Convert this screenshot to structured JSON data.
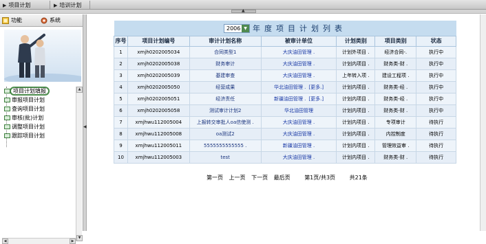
{
  "topbar": {
    "crumb1": "项目计划",
    "crumb2": "培训计划"
  },
  "sidebar": {
    "tab_function": "功能",
    "tab_system": "系统",
    "tree": [
      {
        "label": "项目计划填报",
        "selected": true
      },
      {
        "label": "审报项目计划"
      },
      {
        "label": "查询项目计划"
      },
      {
        "label": "审核(批)计划"
      },
      {
        "label": "调整项目计划"
      },
      {
        "label": "跟踪项目计划"
      }
    ]
  },
  "grid": {
    "year": "2006",
    "title": "年度项目计划列表",
    "headers": [
      "序号",
      "项目计划编号",
      "审计计划名称",
      "被审计单位",
      "计划类别",
      "项目类别",
      "状态"
    ],
    "rows": [
      {
        "no": "1",
        "code": "xmjh0202005034",
        "name": "合同类型1",
        "unit": "大庆油田管理 .",
        "more": "",
        "plan": "计划外项目 .",
        "type": "经济合同-.",
        "status": "执行中"
      },
      {
        "no": "2",
        "code": "xmjh0202005038",
        "name": "财务审计",
        "unit": "大庆油田管理 .",
        "more": "",
        "plan": "计划内项目 .",
        "type": "财务类-财 .",
        "status": "执行中"
      },
      {
        "no": "3",
        "code": "xmjh0202005039",
        "name": "基建审查",
        "unit": "大庆油田管理 .",
        "more": "",
        "plan": "上年转入项 .",
        "type": "建设工程项 .",
        "status": "执行中"
      },
      {
        "no": "4",
        "code": "xmjh0202005050",
        "name": "经营成果",
        "unit": "华北油田管理 .",
        "more": "[更多.]",
        "plan": "计划内项目 .",
        "type": "财务类-经 .",
        "status": "执行中"
      },
      {
        "no": "5",
        "code": "xmjh0202005051",
        "name": "经济责任",
        "unit": "新疆油田管理 .",
        "more": "[更多.]",
        "plan": "计划内项目 .",
        "type": "财务类-经 .",
        "status": "执行中"
      },
      {
        "no": "6",
        "code": "xmjh0202005058",
        "name": "测试审计计划2",
        "unit": "华北油田管理",
        "more": "",
        "plan": "计划内项目 .",
        "type": "财务类-财 .",
        "status": "执行中"
      },
      {
        "no": "7",
        "code": "xmjhwu112005004",
        "name": "上报转交审批人oa信使测 .",
        "unit": "大庆油田管理 .",
        "more": "",
        "plan": "计划内项目 .",
        "type": "专项审计",
        "status": "待执行"
      },
      {
        "no": "8",
        "code": "xmjhwu112005008",
        "name": "oa测试2",
        "unit": "大庆油田管理 .",
        "more": "",
        "plan": "计划内项目 .",
        "type": "内控制度",
        "status": "待执行"
      },
      {
        "no": "9",
        "code": "xmjhwu112005011",
        "name": "5555555555555 .",
        "unit": "新疆油田管理 .",
        "more": "",
        "plan": "计划内项目 .",
        "type": "管理效益审 .",
        "status": "待执行"
      },
      {
        "no": "10",
        "code": "xmjhwu112005003",
        "name": "test",
        "unit": "大庆油田管理 .",
        "more": "",
        "plan": "计划内项目 .",
        "type": "财务类-财 .",
        "status": "待执行"
      }
    ]
  },
  "pager": {
    "first": "第一页",
    "prev": "上一页",
    "next": "下一页",
    "last": "最后页",
    "page_info": "第1页/共3页",
    "total": "共21条"
  }
}
